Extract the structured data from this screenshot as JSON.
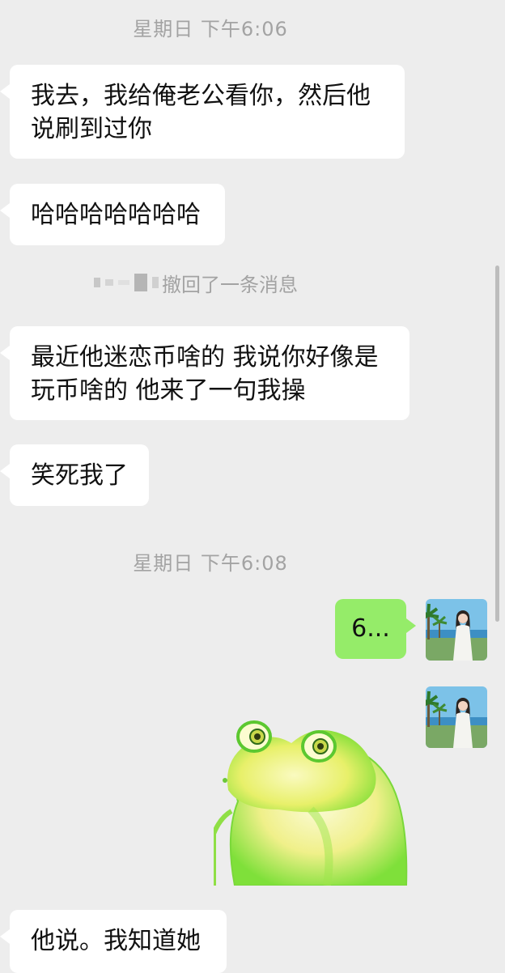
{
  "chat": {
    "timestamp_1": "星期日 下午6:06",
    "msg_1": "我去，我给俺老公看你，然后他说刷到过你",
    "msg_2": "哈哈哈哈哈哈哈",
    "recall_notice": "撤回了一条消息",
    "msg_3": "最近他迷恋币啥的 我说你好像是玩币啥的 他来了一句我操",
    "msg_4": "笑死我了",
    "timestamp_2": "星期日 下午6:08",
    "msg_5": "6...",
    "msg_6": "他说。我知道她"
  },
  "colors": {
    "background": "#ededed",
    "incoming_bubble": "#ffffff",
    "outgoing_bubble": "#95ec69",
    "meta_text": "#a3a3a3"
  },
  "icons": {
    "avatar": "avatar-photo",
    "sticker": "frog-sticker"
  }
}
